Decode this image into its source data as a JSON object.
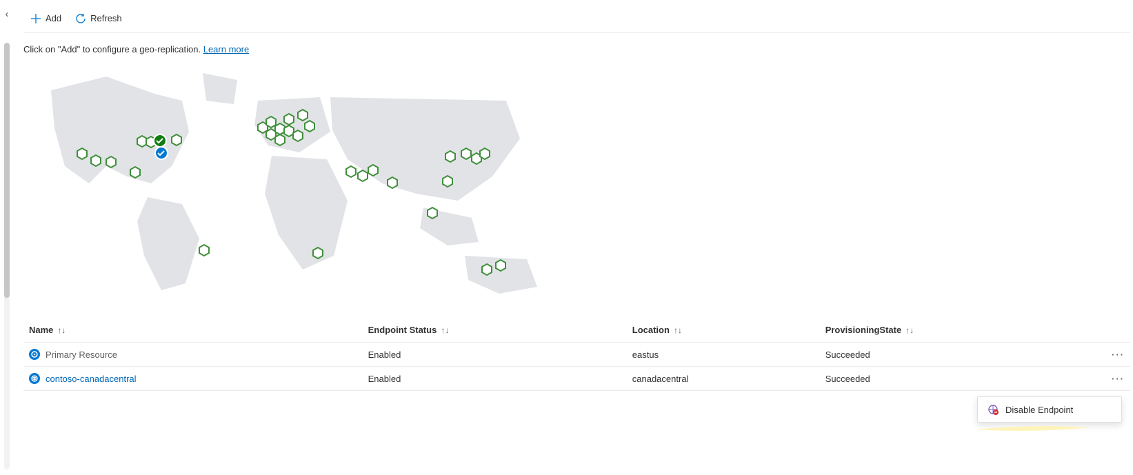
{
  "toolbar": {
    "add_label": "Add",
    "refresh_label": "Refresh"
  },
  "intro": {
    "text": "Click on \"Add\" to configure a geo-replication. ",
    "link": "Learn more"
  },
  "table": {
    "headers": {
      "name": "Name",
      "endpoint_status": "Endpoint Status",
      "location": "Location",
      "provisioning_state": "ProvisioningState"
    },
    "sort_glyph": "↑↓",
    "rows": [
      {
        "name": "Primary Resource",
        "endpoint_status": "Enabled",
        "location": "eastus",
        "provisioning_state": "Succeeded",
        "is_link": false,
        "icon_color": "#0078d4"
      },
      {
        "name": "contoso-canadacentral",
        "endpoint_status": "Enabled",
        "location": "canadacentral",
        "provisioning_state": "Succeeded",
        "is_link": true,
        "icon_color": "#0078d4"
      }
    ]
  },
  "context_menu": {
    "disable_label": "Disable Endpoint"
  },
  "map": {
    "pins": [
      {
        "color": "#107c10",
        "label": "canadacentral"
      },
      {
        "color": "#0078d4",
        "label": "eastus"
      }
    ]
  }
}
